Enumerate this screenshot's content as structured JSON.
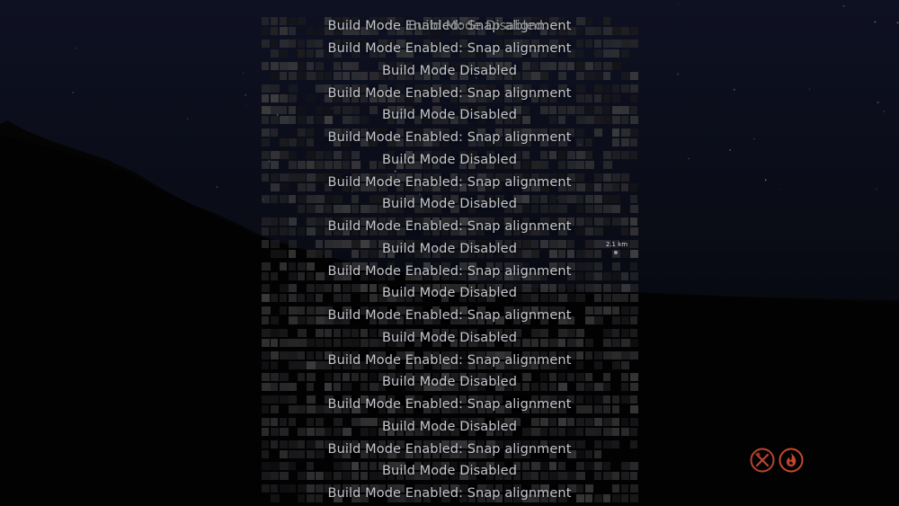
{
  "scene": {
    "sky_color": "#0e1122",
    "ground_color": "#050608"
  },
  "notifications": {
    "overlapping_top": {
      "enabled_text": "Build Mode Enabled: Snap alignment",
      "disabled_text": "Build Mode Disabled"
    },
    "lines": [
      "Build Mode Enabled: Snap alignment",
      "Build Mode Disabled",
      "Build Mode Enabled: Snap alignment",
      "Build Mode Disabled",
      "Build Mode Enabled: Snap alignment",
      "Build Mode Disabled",
      "Build Mode Enabled: Snap alignment",
      "Build Mode Disabled",
      "Build Mode Enabled: Snap alignment",
      "Build Mode Disabled",
      "Build Mode Enabled: Snap alignment",
      "Build Mode Disabled",
      "Build Mode Enabled: Snap alignment",
      "Build Mode Disabled",
      "Build Mode Enabled: Snap alignment",
      "Build Mode Disabled",
      "Build Mode Enabled: Snap alignment",
      "Build Mode Disabled",
      "Build Mode Enabled: Snap alignment",
      "Build Mode Disabled",
      "Build Mode Enabled: Snap alignment"
    ],
    "text_color": "#c4c6cc"
  },
  "waypoint": {
    "distance_label": "2.1 km"
  },
  "status_icons": [
    {
      "name": "hunger-icon",
      "color": "#b8442c"
    },
    {
      "name": "fire-icon",
      "color": "#c8472c"
    }
  ]
}
